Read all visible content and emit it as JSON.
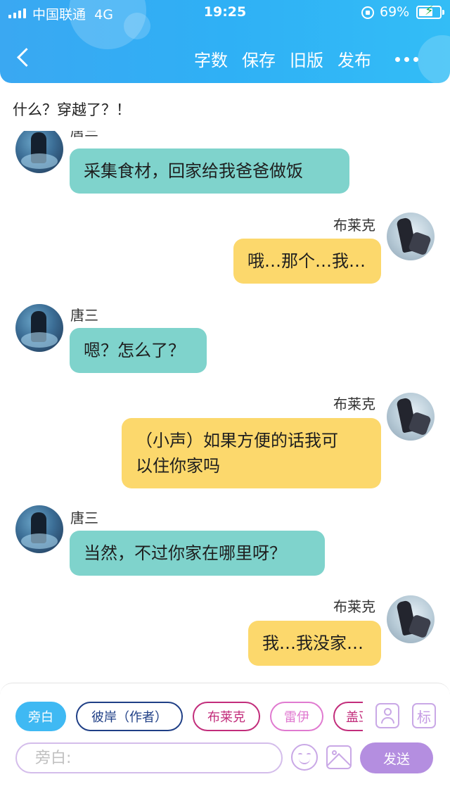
{
  "status_bar": {
    "carrier": "中国联通",
    "network": "4G",
    "time": "19:25",
    "battery_percent": "69%",
    "battery_level": 0.69
  },
  "toolbar": {
    "actions": [
      {
        "label": "字数"
      },
      {
        "label": "保存"
      },
      {
        "label": "旧版"
      },
      {
        "label": "发布"
      }
    ]
  },
  "chat": {
    "title": "什么？穿越了？！",
    "partial_sender": "唐三",
    "messages": [
      {
        "side": "left",
        "sender": "唐三",
        "text": "采集食材，回家给我爸爸做饭",
        "show_sender": false
      },
      {
        "side": "right",
        "sender": "布莱克",
        "text": "哦…那个…我…",
        "show_sender": true
      },
      {
        "side": "left",
        "sender": "唐三",
        "text": "嗯？怎么了？",
        "show_sender": true
      },
      {
        "side": "right",
        "sender": "布莱克",
        "text": "（小声）如果方便的话我可\n以住你家吗",
        "show_sender": true
      },
      {
        "side": "left",
        "sender": "唐三",
        "text": "当然，不过你家在哪里呀？",
        "show_sender": true
      },
      {
        "side": "right",
        "sender": "布莱克",
        "text": "我…我没家…",
        "show_sender": true
      }
    ]
  },
  "role_chips": [
    {
      "label": "旁白",
      "selected": true,
      "color": "#3fb9f3"
    },
    {
      "label": "彼岸（作者）",
      "selected": false,
      "color": "#1f3f86"
    },
    {
      "label": "布莱克",
      "selected": false,
      "color": "#c22d7b"
    },
    {
      "label": "雷伊",
      "selected": false,
      "color": "#e07ad0"
    },
    {
      "label": "盖亚",
      "selected": false,
      "color": "#c22d7b"
    }
  ],
  "tag_button_label": "标",
  "input": {
    "placeholder": "旁白:",
    "value": ""
  },
  "send_label": "发送",
  "colors": {
    "header": "#33b0f4",
    "bubble_left": "#7fd3cc",
    "bubble_right": "#fcd86c",
    "send_button": "#b48ee0"
  }
}
